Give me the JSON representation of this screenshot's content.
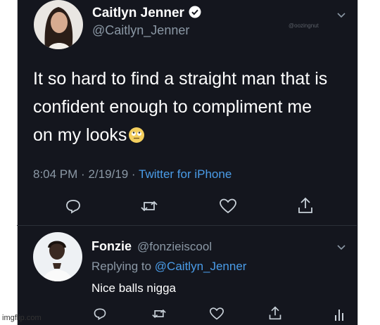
{
  "tweet": {
    "name": "Caitlyn Jenner",
    "handle": "@Caitlyn_Jenner",
    "watermark": "@oozingnut",
    "text": "It so hard to find a straight man that is confident enough to compliment me on my looks",
    "emoji": "face-with-rolling-eyes",
    "time": "8:04 PM",
    "date": "2/19/19",
    "separator": "·",
    "source": "Twitter for iPhone",
    "actions": [
      "reply-icon",
      "retweet-icon",
      "like-icon",
      "share-icon"
    ]
  },
  "reply": {
    "name": "Fonzie",
    "handle": "@fonzieiscool",
    "replying_prefix": "Replying to",
    "replying_mention": "@Caitlyn_Jenner",
    "text": "Nice balls nigga",
    "actions": [
      "reply-icon",
      "retweet-icon",
      "like-icon",
      "share-icon",
      "analytics-icon"
    ]
  },
  "footer": {
    "watermark": "imgflip.com"
  },
  "colors": {
    "background": "#14161e",
    "accent": "#4a9ce8",
    "muted": "#8b98a5",
    "verified": "#ffffff"
  }
}
